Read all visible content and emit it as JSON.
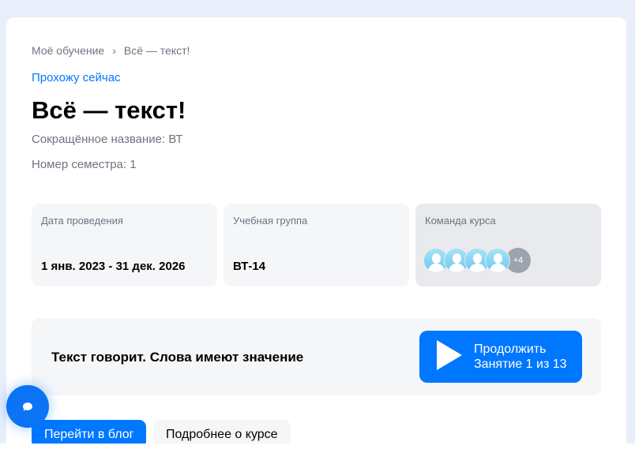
{
  "breadcrumb": {
    "items": [
      "Моё обучение",
      "Всё — текст!"
    ]
  },
  "status": "Прохожу сейчас",
  "title": "Всё — текст!",
  "short_name": "Сокращённое название: ВТ",
  "semester": "Номер семестра: 1",
  "info": {
    "date": {
      "label": "Дата проведения",
      "value": "1 янв. 2023 - 31 дек. 2026"
    },
    "group": {
      "label": "Учебная группа",
      "value": "ВТ-14"
    },
    "team": {
      "label": "Команда курса",
      "more": "+4"
    }
  },
  "lesson": {
    "title": "Текст говорит. Слова имеют значение",
    "button_line1": "Продолжить",
    "button_line2": "Занятие 1 из 13"
  },
  "buttons": {
    "blog": "Перейти в блог",
    "more": "Подробнее о курсе"
  }
}
